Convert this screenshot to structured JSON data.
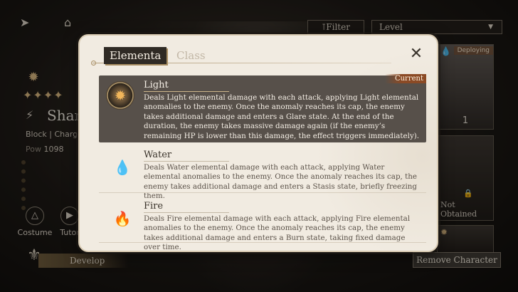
{
  "background": {
    "top_icons": [
      "back-icon",
      "home-icon"
    ],
    "character": {
      "name": "Shan",
      "role": "Block | Charge",
      "power_label": "Pow",
      "power_value": "1098"
    },
    "buttons": [
      {
        "label": "Costume",
        "icon": "shirt-icon"
      },
      {
        "label": "Tutor",
        "icon": "play-icon"
      }
    ],
    "develop_label": "Develop",
    "filter_label": "Filter",
    "level_label": "Level",
    "cards": [
      {
        "badge": "Deploying",
        "count": "1"
      },
      {
        "status": "Not Obtained"
      },
      {}
    ],
    "remove_button": "Remove Character"
  },
  "modal": {
    "tabs": [
      "Elementa",
      "Class"
    ],
    "active_tab": 0,
    "current_badge": "Current",
    "elements": [
      {
        "name": "Light",
        "icon": "light-sun-icon",
        "description": "Deals Light elemental damage with each attack, applying Light elemental anomalies to the enemy. Once the anomaly reaches its cap, the enemy takes additional damage and enters a Glare state. At the end of the duration, the enemy takes massive damage again (if the enemy’s remaining HP is lower than this damage, the effect triggers immediately)."
      },
      {
        "name": "Water",
        "icon": "water-drop-icon",
        "description": "Deals Water elemental damage with each attack, applying Water elemental anomalies to the enemy. Once the anomaly reaches its cap, the enemy takes additional damage and enters a Stasis state, briefly freezing them."
      },
      {
        "name": "Fire",
        "icon": "fire-flame-icon",
        "description": "Deals Fire elemental damage with each attack, applying Fire elemental anomalies to the enemy. Once the anomaly reaches its cap, the enemy takes additional damage and enters a Burn state, taking fixed damage over time."
      }
    ],
    "colors": {
      "panel": "#f1ebe1",
      "selected_row": "#57504a",
      "current_badge": "#8b4a25",
      "water": "#58a6df",
      "fire": "#e26964",
      "light": "#f2b65a"
    }
  }
}
